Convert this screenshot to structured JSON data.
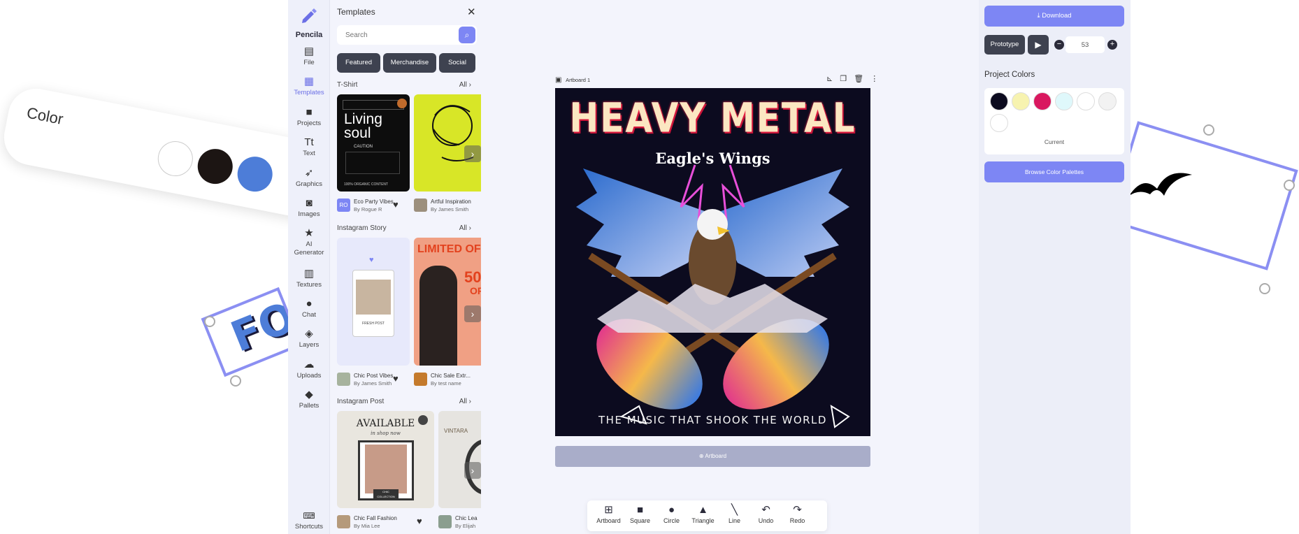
{
  "background": {
    "color_card_label": "Color",
    "color_card_swatches": [
      "#ffffff",
      "#1c1513",
      "#4d7dd8"
    ],
    "fo_text": "FO"
  },
  "brand": {
    "name": "Pencila"
  },
  "rail": {
    "items": [
      {
        "label": "File",
        "icon": "file-icon"
      },
      {
        "label": "Templates",
        "icon": "templates-icon"
      },
      {
        "label": "Projects",
        "icon": "folder-icon"
      },
      {
        "label": "Text",
        "icon": "text-icon"
      },
      {
        "label": "Graphics",
        "icon": "rocket-icon"
      },
      {
        "label": "Images",
        "icon": "camera-icon"
      },
      {
        "label": "AI Generator",
        "icon": "sparkle-icon"
      },
      {
        "label": "Textures",
        "icon": "texture-icon"
      },
      {
        "label": "Chat",
        "icon": "chat-icon"
      },
      {
        "label": "Layers",
        "icon": "layers-icon"
      },
      {
        "label": "Uploads",
        "icon": "upload-icon"
      },
      {
        "label": "Pallets",
        "icon": "paint-bucket-icon"
      }
    ],
    "shortcuts": "Shortcuts"
  },
  "panel": {
    "title": "Templates",
    "search_placeholder": "Search",
    "chips": [
      "Featured",
      "Merchandise",
      "Social"
    ],
    "all_label": "All",
    "sections": [
      {
        "title": "T-Shirt",
        "thumb1_text": "Living soul",
        "thumb1_caution": "CAUTION",
        "thumb1_footer": "100% ORGANIC CONTENT",
        "cards": [
          {
            "name": "Eco Party Vibes",
            "author": "By Rogue R",
            "initials": "RO"
          },
          {
            "name": "Artful Inspiration",
            "author": "By James Smith"
          }
        ]
      },
      {
        "title": "Instagram Story",
        "thumb2_text": "LIMITED OFFE",
        "thumb2_price": "50",
        "thumb2_unit": "OF",
        "thumb1_caption": "FRESH POST",
        "cards": [
          {
            "name": "Chic Post Vibes",
            "author": "By James Smith"
          },
          {
            "name": "Chic Sale Extr...",
            "author": "By test name"
          }
        ]
      },
      {
        "title": "Instagram Post",
        "thumb1_heading": "AVAILABLE",
        "thumb1_script": "in shop now",
        "thumb1_tag": "CHIC COLLECTION",
        "thumb2_heading": "VINTARA",
        "cards": [
          {
            "name": "Chic Fall Fashion",
            "author": "By Mia Lee"
          },
          {
            "name": "Chic Lea",
            "author": "By Elijah"
          }
        ]
      }
    ]
  },
  "canvas": {
    "artboard_label": "Artboard 1",
    "design": {
      "title": "HEAVY METAL",
      "subtitle": "Eagle's Wings",
      "footer": "THE MUSIC THAT SHOOK THE WORLD"
    },
    "add_artboard": "Artboard"
  },
  "toolbar": {
    "tools": [
      {
        "label": "Artboard",
        "icon": "artboard-icon"
      },
      {
        "label": "Square",
        "icon": "square-icon"
      },
      {
        "label": "Circle",
        "icon": "circle-icon"
      },
      {
        "label": "Triangle",
        "icon": "triangle-icon"
      },
      {
        "label": "Line",
        "icon": "line-icon"
      },
      {
        "label": "Undo",
        "icon": "undo-icon"
      },
      {
        "label": "Redo",
        "icon": "redo-icon"
      }
    ]
  },
  "right_panel": {
    "download": "Download",
    "prototype": "Prototype",
    "zoom_value": "53",
    "project_colors_title": "Project Colors",
    "swatches": [
      "#0c0b1f",
      "#f7f3b0",
      "#d9185f",
      "#dff8fb",
      "#ffffff",
      "#f2f2f2",
      "#ffffff"
    ],
    "current_label": "Current",
    "browse": "Browse Color Palettes"
  },
  "colors": {
    "accent": "#7d86f4",
    "dark_button": "#3e4250",
    "app_bg": "#f3f4fc"
  }
}
